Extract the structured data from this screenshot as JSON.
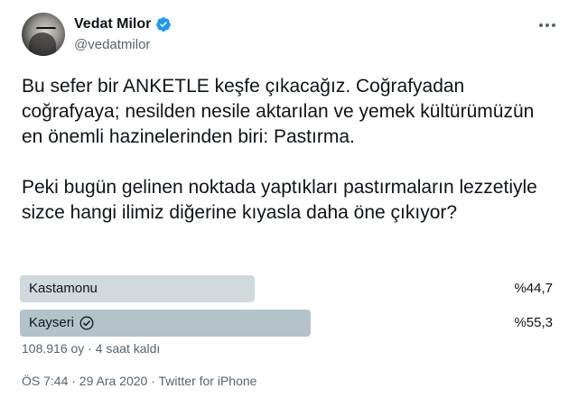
{
  "author": {
    "display_name": "Vedat Milor",
    "handle": "@vedatmilor",
    "verified": true,
    "avatar_icon": "profile-photo"
  },
  "tweet": {
    "text": "Bu sefer bir ANKETLE keşfe çıkacağız. Coğrafyadan coğrafyaya; nesilden nesile aktarılan ve yemek kültürümüzün en önemli hazinelerinden biri: Pastırma.\n\nPeki bugün gelinen noktada yaptıkları pastırmaların lezzetiyle sizce hangi ilimiz diğerine kıyasla daha öne çıkıyor?"
  },
  "poll": {
    "options": [
      {
        "label": "Kastamonu",
        "percent_text": "%44,7",
        "share": 0.447,
        "winner": false
      },
      {
        "label": "Kayseri",
        "percent_text": "%55,3",
        "share": 0.553,
        "winner": true
      }
    ],
    "meta": "108.916 oy · 4 saat kaldı"
  },
  "footer": {
    "timestamp": "ÖS 7:44 · 29 Ara 2020 · Twitter for iPhone"
  },
  "colors": {
    "verified_blue": "#1d9bf0",
    "bar_default": "#cfd9de",
    "bar_winner": "#b4c2cb",
    "secondary_text": "#536471"
  }
}
